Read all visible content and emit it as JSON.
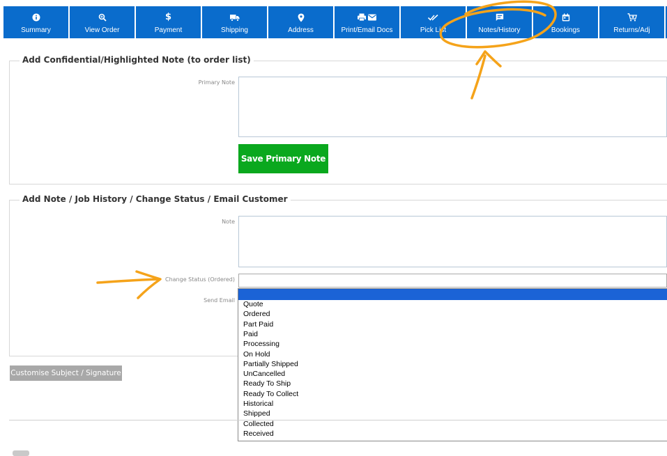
{
  "tabs": [
    {
      "label": "Summary",
      "icon": "info-circle-icon"
    },
    {
      "label": "View Order",
      "icon": "zoom-icon"
    },
    {
      "label": "Payment",
      "icon": "dollar-icon"
    },
    {
      "label": "Shipping",
      "icon": "truck-icon"
    },
    {
      "label": "Address",
      "icon": "map-pin-icon"
    },
    {
      "label": "Print/Email Docs",
      "icon": "print-email-icon"
    },
    {
      "label": "Pick List",
      "icon": "double-check-icon"
    },
    {
      "label": "Notes/History",
      "icon": "note-icon"
    },
    {
      "label": "Bookings",
      "icon": "calendar-icon"
    },
    {
      "label": "Returns/Adj",
      "icon": "cart-icon"
    }
  ],
  "colors": {
    "tab_bg": "#0a6ccc",
    "save_button": "#0aa81e",
    "grey_button": "#a8a8a8",
    "dropdown_highlight": "#1b63d6",
    "annotation": "#f5a31a"
  },
  "primary_section": {
    "legend": "Add Confidential/Highlighted Note (to order list)",
    "primary_note_label": "Primary Note",
    "primary_note_value": "",
    "save_button": "Save Primary Note"
  },
  "history_section": {
    "legend": "Add Note / Job History / Change Status / Email Customer",
    "note_label": "Note",
    "note_value": "",
    "change_status_label": "Change Status (Ordered)",
    "send_email_label": "Send Email",
    "status_selected": "",
    "status_options": [
      "Quote",
      "Ordered",
      "Part Paid",
      "Paid",
      "Processing",
      "On Hold",
      "Partially Shipped",
      "UnCancelled",
      "Ready To Ship",
      "Ready To Collect",
      "Historical",
      "Shipped",
      "Collected",
      "Received"
    ]
  },
  "customise_button": "Customise Subject / Signature"
}
